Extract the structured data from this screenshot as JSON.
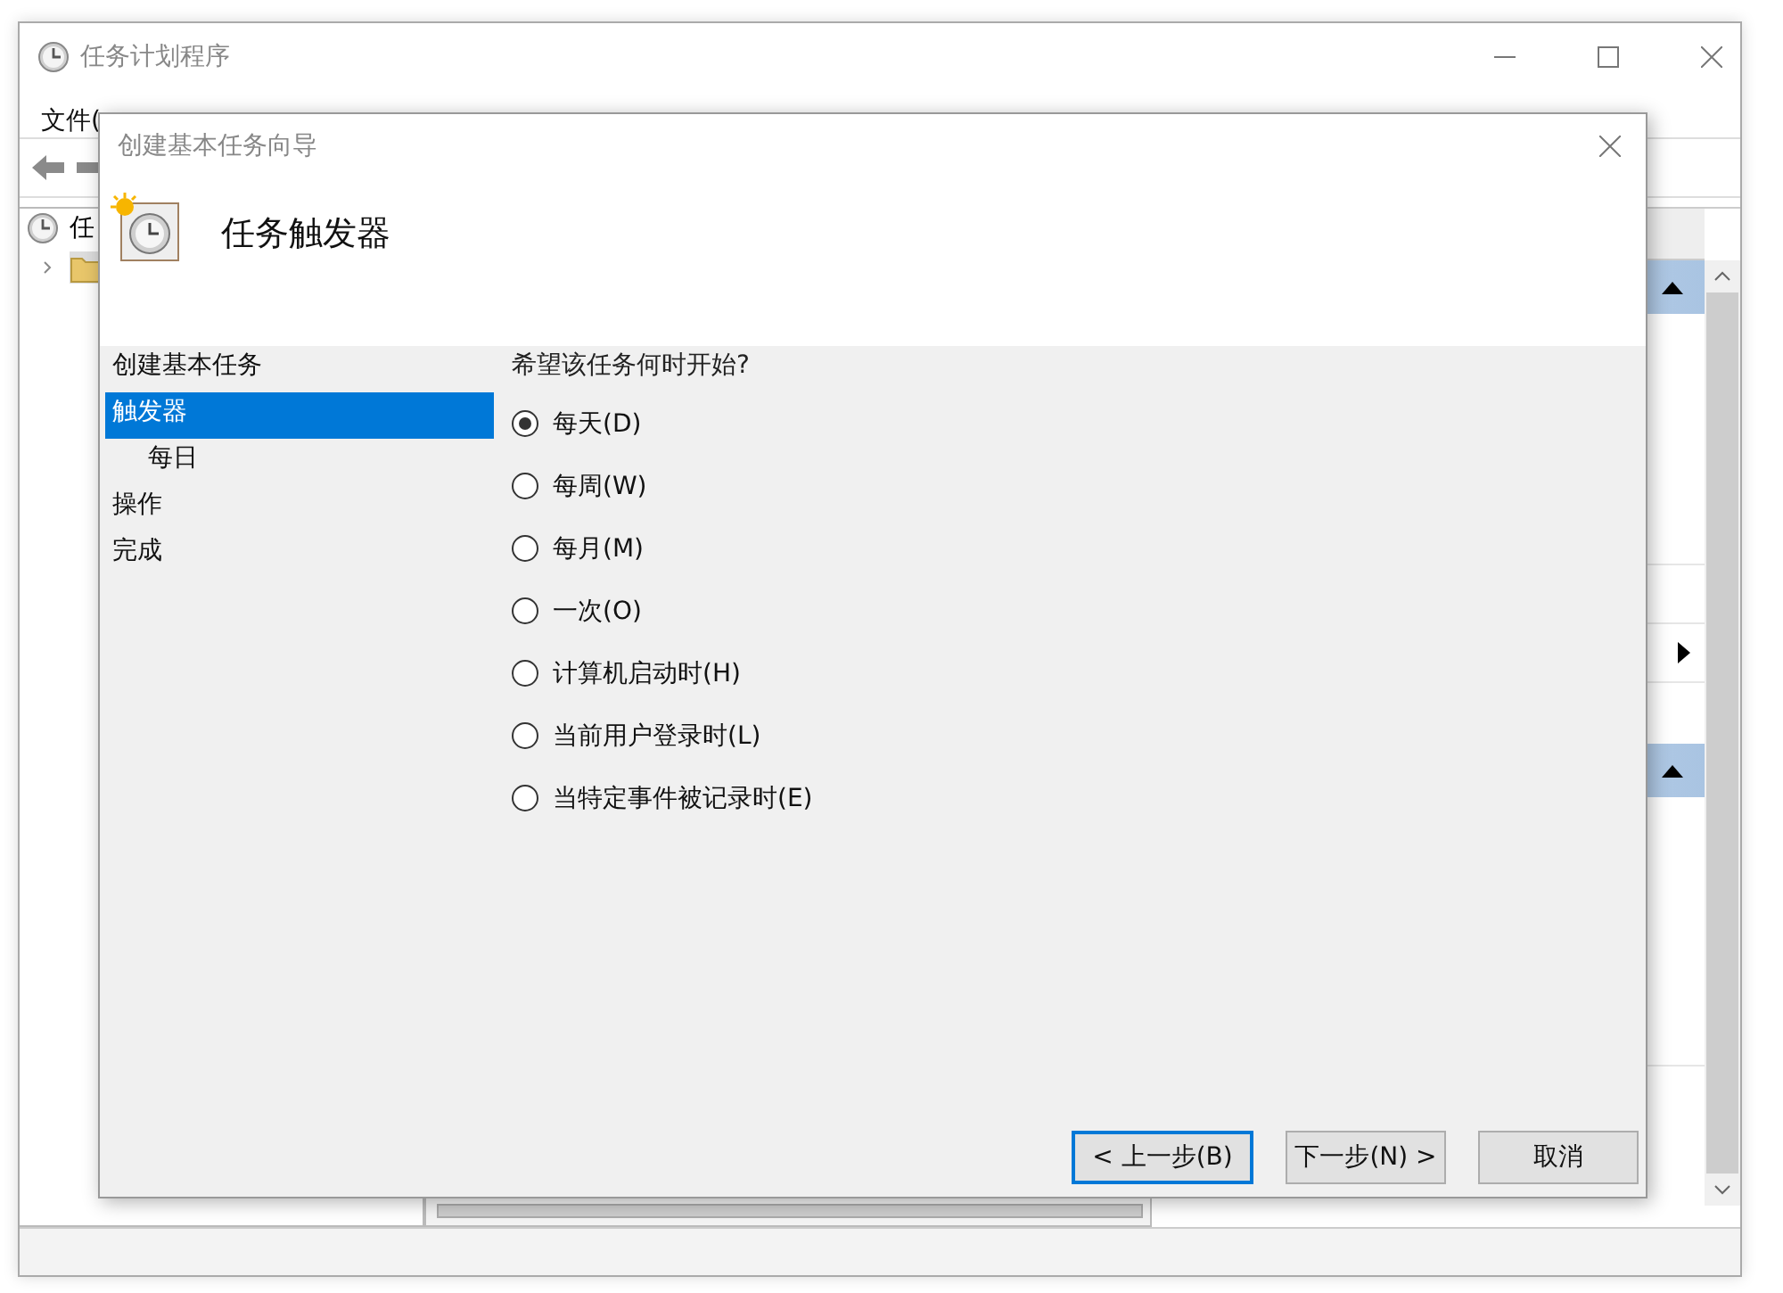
{
  "main_window": {
    "title": "任务计划程序",
    "menu": [
      {
        "label": "文件("
      }
    ],
    "tree": [
      {
        "label": "任",
        "expanded": false
      }
    ]
  },
  "dialog": {
    "title": "创建基本任务向导",
    "heading": "任务触发器",
    "steps": [
      {
        "label": "创建基本任务",
        "selected": false
      },
      {
        "label": "触发器",
        "selected": true,
        "children": [
          {
            "label": "每日",
            "selected": false
          }
        ]
      },
      {
        "label": "操作",
        "selected": false
      },
      {
        "label": "完成",
        "selected": false
      }
    ],
    "prompt": "希望该任务何时开始?",
    "options": [
      {
        "label": "每天(D)",
        "selected": true
      },
      {
        "label": "每周(W)",
        "selected": false
      },
      {
        "label": "每月(M)",
        "selected": false
      },
      {
        "label": "一次(O)",
        "selected": false
      },
      {
        "label": "计算机启动时(H)",
        "selected": false
      },
      {
        "label": "当前用户登录时(L)",
        "selected": false
      },
      {
        "label": "当特定事件被记录时(E)",
        "selected": false
      }
    ],
    "buttons": [
      {
        "label": "< 上一步(B)",
        "default": true
      },
      {
        "label": "下一步(N) >",
        "default": false
      },
      {
        "label": "取消",
        "default": false
      }
    ]
  }
}
